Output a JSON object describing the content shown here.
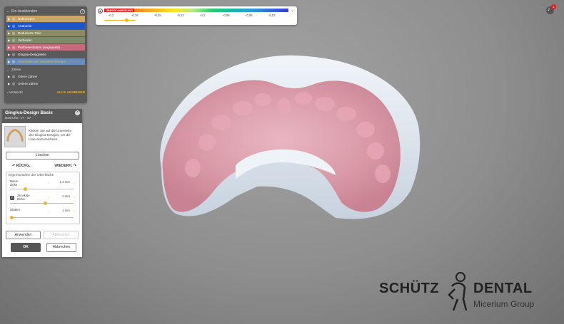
{
  "layer_panel": {
    "header": "Ein-/ausblenden",
    "help_icon": "?",
    "layers": [
      {
        "label": "Referenzen",
        "color": "#c9a567",
        "text_color": "#ffffff"
      },
      {
        "label": "Anatomie",
        "color": "#1e55c8",
        "text_color": "#ffffff"
      },
      {
        "label": "Reduzierte Teile",
        "color": "#8b8b63",
        "text_color": "#ffffff"
      },
      {
        "label": "Verbinder",
        "color": "#7e8a6a",
        "text_color": "#ffffff"
      },
      {
        "label": "Prothesenbasen (angepasst)",
        "color": "#c46b7e",
        "text_color": "#ffffff"
      },
      {
        "label": "Gingiva-Designteile",
        "color": "#5a5a5a",
        "text_color": "#ffffff"
      },
      {
        "label": "Unterseite des virtuellen Waxups",
        "color": "#6b8cb8",
        "text_color": "#f0c000"
      }
    ],
    "teeth_section": "Zähne",
    "teeth": [
      "Obere Zähne",
      "Untere Zähne"
    ],
    "footer_label": "Versteckt",
    "show_all": "ALLE ANZEIGEN"
  },
  "dialog": {
    "title": "Gingiva-Design Basis",
    "subtitle": "Basis für: 17 - 27",
    "instruction": "Klicken Sie auf die Unterseite des Gingiva-Designs, um die Linie einzuzeichnen.",
    "delete": "Löschen",
    "undo": "RÜCKG.",
    "redo": "WIEDERH.",
    "properties_title": "Eigenschaften der Oberfläche",
    "properties": [
      {
        "label": "Basis-dicke",
        "value": "1,4 mm",
        "level": 0.24,
        "has_checkbox": false
      },
      {
        "label": "Zervikale Dicke",
        "value": "1 mm",
        "level": 0.55,
        "has_checkbox": true
      },
      {
        "label": "Glätten",
        "value": "1 mm",
        "level": 0.02,
        "has_checkbox": false
      }
    ],
    "apply": "Anwenden",
    "cancel_disabled": "Abbrechen",
    "ok": "OK",
    "cancel": "Abbrechen"
  },
  "legend": {
    "tag": "ÜBERSCHNEIDUNG",
    "ticks": [
      "-0,2",
      "-0,18",
      "-0,15",
      "-0,13",
      "-0,1",
      "-0,08",
      "-0,05",
      "-0,03"
    ],
    "slider_level": 0.65
  },
  "notifications": {
    "count": "1"
  },
  "logo": {
    "left": "SCHÜTZ",
    "right": "DENTAL",
    "sub": "Micerium Group"
  },
  "colors": {
    "accent": "#f0b429",
    "gingiva": "#d88a9a",
    "base": "#e8eef5",
    "badge": "#e02020"
  }
}
